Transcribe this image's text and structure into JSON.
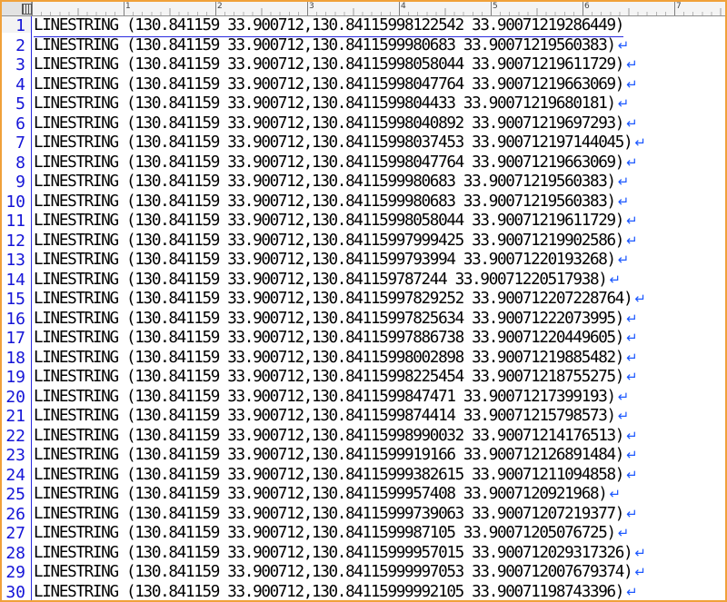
{
  "ruler": {
    "marks": [
      "1",
      "2",
      "3",
      "4",
      "5",
      "6",
      "7"
    ]
  },
  "eol_marker": "↵",
  "lines": [
    {
      "num": "1",
      "text": "LINESTRING (130.841159 33.900712,130.84115998122542 33.90071219286449)",
      "eol": false
    },
    {
      "num": "2",
      "text": "LINESTRING (130.841159 33.900712,130.8411599980683 33.90071219560383)",
      "eol": true
    },
    {
      "num": "3",
      "text": "LINESTRING (130.841159 33.900712,130.84115998058044 33.90071219611729)",
      "eol": true
    },
    {
      "num": "4",
      "text": "LINESTRING (130.841159 33.900712,130.84115998047764 33.90071219663069)",
      "eol": true
    },
    {
      "num": "5",
      "text": "LINESTRING (130.841159 33.900712,130.8411599804433 33.90071219680181)",
      "eol": true
    },
    {
      "num": "6",
      "text": "LINESTRING (130.841159 33.900712,130.84115998040892 33.90071219697293)",
      "eol": true
    },
    {
      "num": "7",
      "text": "LINESTRING (130.841159 33.900712,130.84115998037453 33.900712197144045)",
      "eol": true
    },
    {
      "num": "8",
      "text": "LINESTRING (130.841159 33.900712,130.84115998047764 33.90071219663069)",
      "eol": true
    },
    {
      "num": "9",
      "text": "LINESTRING (130.841159 33.900712,130.8411599980683 33.90071219560383)",
      "eol": true
    },
    {
      "num": "10",
      "text": "LINESTRING (130.841159 33.900712,130.8411599980683 33.90071219560383)",
      "eol": true
    },
    {
      "num": "11",
      "text": "LINESTRING (130.841159 33.900712,130.84115998058044 33.90071219611729)",
      "eol": true
    },
    {
      "num": "12",
      "text": "LINESTRING (130.841159 33.900712,130.84115997999425 33.90071219902586)",
      "eol": true
    },
    {
      "num": "13",
      "text": "LINESTRING (130.841159 33.900712,130.8411599793994 33.90071220193268)",
      "eol": true
    },
    {
      "num": "14",
      "text": "LINESTRING (130.841159 33.900712,130.841159787244 33.90071220517938)",
      "eol": true
    },
    {
      "num": "15",
      "text": "LINESTRING (130.841159 33.900712,130.84115997829252 33.900712207228764)",
      "eol": true
    },
    {
      "num": "16",
      "text": "LINESTRING (130.841159 33.900712,130.84115997825634 33.90071222073995)",
      "eol": true
    },
    {
      "num": "17",
      "text": "LINESTRING (130.841159 33.900712,130.84115997886738 33.90071220449605)",
      "eol": true
    },
    {
      "num": "18",
      "text": "LINESTRING (130.841159 33.900712,130.84115998002898 33.90071219885482)",
      "eol": true
    },
    {
      "num": "19",
      "text": "LINESTRING (130.841159 33.900712,130.84115998225454 33.90071218755275)",
      "eol": true
    },
    {
      "num": "20",
      "text": "LINESTRING (130.841159 33.900712,130.8411599847471 33.90071217399193)",
      "eol": true
    },
    {
      "num": "21",
      "text": "LINESTRING (130.841159 33.900712,130.8411599874414 33.90071215798573)",
      "eol": true
    },
    {
      "num": "22",
      "text": "LINESTRING (130.841159 33.900712,130.84115998990032 33.90071214176513)",
      "eol": true
    },
    {
      "num": "23",
      "text": "LINESTRING (130.841159 33.900712,130.8411599919166 33.900712126891484)",
      "eol": true
    },
    {
      "num": "24",
      "text": "LINESTRING (130.841159 33.900712,130.84115999382615 33.90071211094858)",
      "eol": true
    },
    {
      "num": "25",
      "text": "LINESTRING (130.841159 33.900712,130.8411599957408 33.9007120921968)",
      "eol": true
    },
    {
      "num": "26",
      "text": "LINESTRING (130.841159 33.900712,130.84115999739063 33.90071207219377)",
      "eol": true
    },
    {
      "num": "27",
      "text": "LINESTRING (130.841159 33.900712,130.8411599987105 33.90071205076725)",
      "eol": true
    },
    {
      "num": "28",
      "text": "LINESTRING (130.841159 33.900712,130.84115999957015 33.900712029317326)",
      "eol": true
    },
    {
      "num": "29",
      "text": "LINESTRING (130.841159 33.900712,130.84115999997053 33.900712007679374)",
      "eol": true
    },
    {
      "num": "30",
      "text": "LINESTRING (130.841159 33.900712,130.84115999992105 33.90071198743396)",
      "eol": true
    }
  ]
}
